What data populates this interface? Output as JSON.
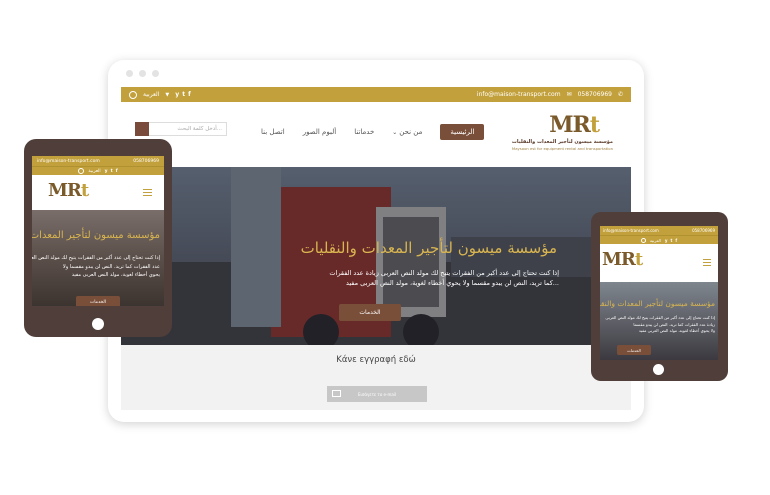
{
  "desktop": {
    "topbar": {
      "language": "العربية",
      "email": "info@maison-transport.com",
      "phone": "058706969",
      "social": [
        "f",
        "t",
        "y"
      ]
    },
    "nav": {
      "search_placeholder": "أدخل كلمة البحث...",
      "menu": [
        "الرئيسية",
        "من نحن",
        "خدماتنا",
        "ألبوم الصور",
        "اتصل بنا"
      ]
    },
    "logo": {
      "mark_left": "MR",
      "mark_right": "t",
      "name_ar": "مؤسسة ميسون لتأجير المعدات والنقليات",
      "name_en": "Maysoon est for equipment rental and transportation"
    },
    "hero": {
      "title": "مؤسسة ميسون لتأجير المعدات والنقليات",
      "text": "إذا كنت تحتاج إلى عدد أكبر من الفقرات يتيح لك مولد النص العربى زيادة عدد الفقرات كما تريد، النص لن يبدو مقسما ولا يحوي أخطاء لغوية، مولد النص العربى مفيد...",
      "button": "الخدمات"
    },
    "subscribe": {
      "title": "Κάνε εγγραφή εδώ",
      "field_placeholder": "Εισάγετε το e-mail"
    }
  },
  "tablet": {
    "email": "info@maison-transport.com",
    "phone": "058706969",
    "language": "العربية",
    "hero_title": "مؤسسة ميسون لتأجير المعدات والنقليات",
    "hero_text_1": "إذا كنت تحتاج إلى عدد أكبر من الفقرات يتيح لك مولد النص العربى زيادة",
    "hero_text_2": "عدد الفقرات كما تريد. النص لن يبدو مقسما ولا",
    "hero_text_3": "يحوي أخطاء لغوية، مولد النص العربى مفيد",
    "button": "الخدمات"
  },
  "phone": {
    "email": "info@maison-transport.com",
    "phone": "058706969",
    "language": "العربية",
    "hero_title": "مؤسسة ميسون لتأجير المعدات والنقليات",
    "hero_text_1": "إذا كنت تحتاج إلى عدد أكبر من الفقرات يتيح لك مولد النص العربى",
    "hero_text_2": "زيادة عدد الفقرات كما تريد. النص لن يبدو مقسما",
    "hero_text_3": "ولا يحوي أخطاء لغوية، مولد النص العربى مفيد",
    "button": "الخدمات"
  },
  "colors": {
    "gold": "#c2a03b",
    "brown": "#7a4f3a",
    "device": "#4f3e39"
  }
}
